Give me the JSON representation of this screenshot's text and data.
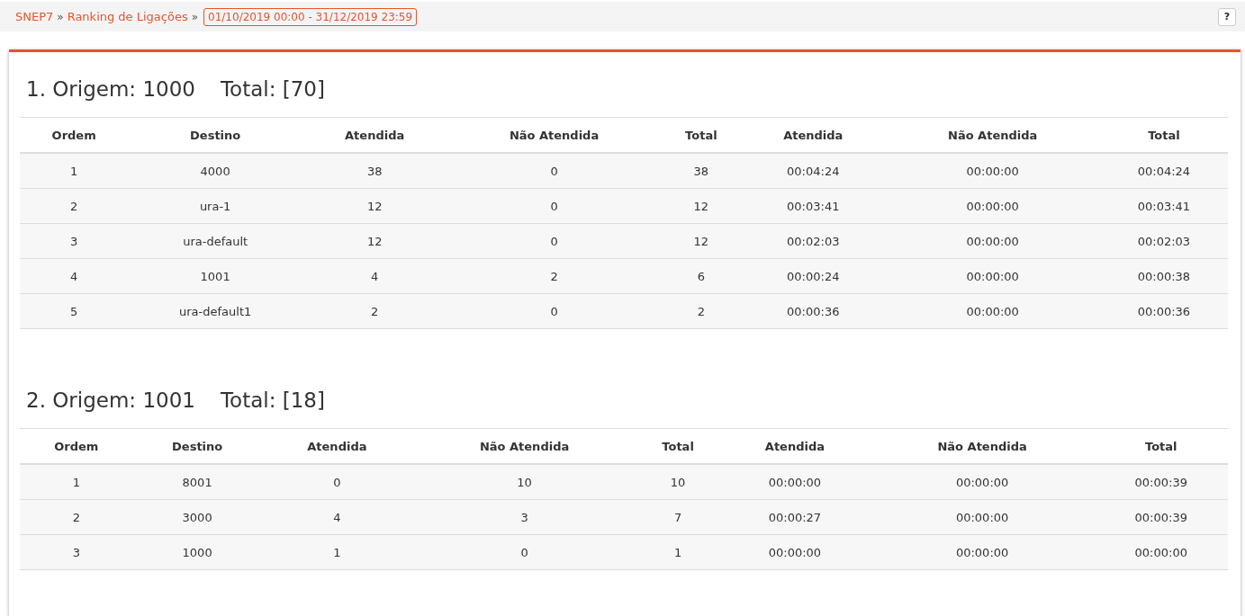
{
  "breadcrumb": {
    "items": [
      "SNEP7",
      "Ranking de Ligações"
    ],
    "separator": "»",
    "period": "01/10/2019 00:00 - 31/12/2019 23:59"
  },
  "help_button": "?",
  "sections": [
    {
      "title": "1. Origem: 1000",
      "total": "Total: [70]",
      "columns": [
        "Ordem",
        "Destino",
        "Atendida",
        "Não Atendida",
        "Total",
        "Atendida",
        "Não Atendida",
        "Total"
      ],
      "rows": [
        [
          "1",
          "4000",
          "38",
          "0",
          "38",
          "00:04:24",
          "00:00:00",
          "00:04:24"
        ],
        [
          "2",
          "ura-1",
          "12",
          "0",
          "12",
          "00:03:41",
          "00:00:00",
          "00:03:41"
        ],
        [
          "3",
          "ura-default",
          "12",
          "0",
          "12",
          "00:02:03",
          "00:00:00",
          "00:02:03"
        ],
        [
          "4",
          "1001",
          "4",
          "2",
          "6",
          "00:00:24",
          "00:00:00",
          "00:00:38"
        ],
        [
          "5",
          "ura-default1",
          "2",
          "0",
          "2",
          "00:00:36",
          "00:00:00",
          "00:00:36"
        ]
      ]
    },
    {
      "title": "2. Origem: 1001",
      "total": "Total: [18]",
      "columns": [
        "Ordem",
        "Destino",
        "Atendida",
        "Não Atendida",
        "Total",
        "Atendida",
        "Não Atendida",
        "Total"
      ],
      "rows": [
        [
          "1",
          "8001",
          "0",
          "10",
          "10",
          "00:00:00",
          "00:00:00",
          "00:00:39"
        ],
        [
          "2",
          "3000",
          "4",
          "3",
          "7",
          "00:00:27",
          "00:00:00",
          "00:00:39"
        ],
        [
          "3",
          "1000",
          "1",
          "0",
          "1",
          "00:00:00",
          "00:00:00",
          "00:00:00"
        ]
      ]
    }
  ]
}
